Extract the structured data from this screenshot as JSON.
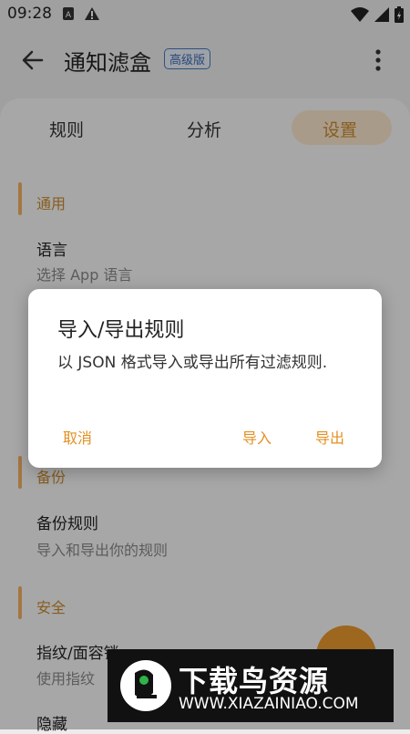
{
  "status_bar": {
    "time": "09:28"
  },
  "app_bar": {
    "title": "通知滤盒",
    "badge": "高级版"
  },
  "tabs": [
    {
      "label": "规则"
    },
    {
      "label": "分析"
    },
    {
      "label": "设置",
      "selected": true
    }
  ],
  "settings": {
    "general": {
      "title": "通用",
      "language": {
        "title": "语言",
        "subtitle": "选择 App 语言"
      }
    },
    "backup": {
      "title": "备份",
      "backup_rules": {
        "title": "备份规则",
        "subtitle": "导入和导出你的规则"
      }
    },
    "security": {
      "title": "安全",
      "fingerprint": {
        "title": "指纹/面容锁",
        "subtitle": "使用指纹"
      },
      "hide": {
        "title": "隐藏"
      }
    }
  },
  "dialog": {
    "title": "导入/导出规则",
    "body": "以 JSON 格式导入或导出所有过滤规则.",
    "cancel": "取消",
    "import": "导入",
    "export": "导出"
  },
  "watermark": {
    "title": "下载鸟资源",
    "url": "WWW.XIAZAINIAO.COM"
  },
  "colors": {
    "accent": "#e39022",
    "badge": "#3d6bb0"
  }
}
